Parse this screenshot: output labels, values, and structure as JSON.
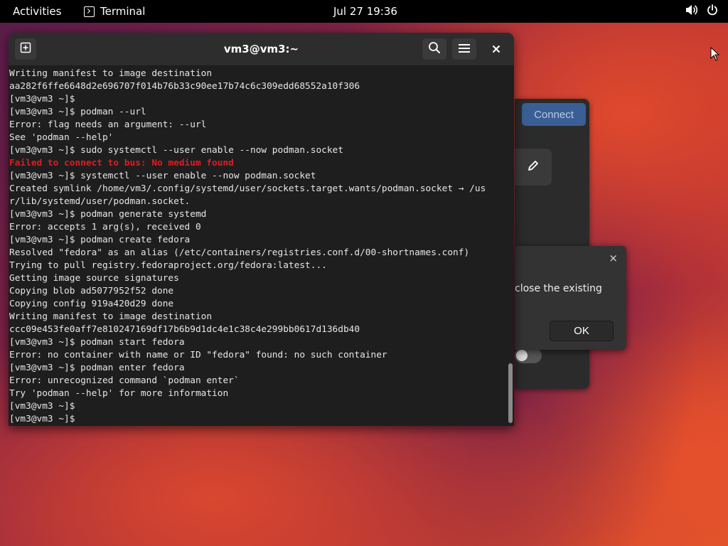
{
  "topbar": {
    "activities": "Activities",
    "app_name": "Terminal",
    "clock": "Jul 27  19:36",
    "icons": [
      "terminal-icon",
      "volume-icon",
      "power-icon"
    ]
  },
  "background_app": {
    "connect_label": "Connect",
    "icons": [
      "pencil-icon"
    ]
  },
  "dialog": {
    "message": "close the existing",
    "ok_label": "OK",
    "close_glyph": "×"
  },
  "terminal": {
    "title": "vm3@vm3:~",
    "icons": [
      "new-tab-icon",
      "search-icon",
      "menu-icon",
      "close-icon"
    ],
    "error_color": "#e01b24",
    "lines": [
      {
        "text": "Writing manifest to image destination"
      },
      {
        "text": "aa282f6ffe6648d2e696707f014b76b33c90ee17b74c6c309edd68552a10f306"
      },
      {
        "text": "[vm3@vm3 ~]$"
      },
      {
        "text": "[vm3@vm3 ~]$ podman --url"
      },
      {
        "text": "Error: flag needs an argument: --url"
      },
      {
        "text": "See 'podman --help'"
      },
      {
        "text": "[vm3@vm3 ~]$ sudo systemctl --user enable --now podman.socket"
      },
      {
        "text": "Failed to connect to bus: No medium found",
        "error": true
      },
      {
        "text": "[vm3@vm3 ~]$ systemctl --user enable --now podman.socket"
      },
      {
        "text": "Created symlink /home/vm3/.config/systemd/user/sockets.target.wants/podman.socket → /us"
      },
      {
        "text": "r/lib/systemd/user/podman.socket."
      },
      {
        "text": "[vm3@vm3 ~]$ podman generate systemd"
      },
      {
        "text": "Error: accepts 1 arg(s), received 0"
      },
      {
        "text": "[vm3@vm3 ~]$ podman create fedora"
      },
      {
        "text": "Resolved \"fedora\" as an alias (/etc/containers/registries.conf.d/00-shortnames.conf)"
      },
      {
        "text": "Trying to pull registry.fedoraproject.org/fedora:latest..."
      },
      {
        "text": "Getting image source signatures"
      },
      {
        "text": "Copying blob ad5077952f52 done"
      },
      {
        "text": "Copying config 919a420d29 done"
      },
      {
        "text": "Writing manifest to image destination"
      },
      {
        "text": "ccc09e453fe0aff7e810247169df17b6b9d1dc4e1c38c4e299bb0617d136db40"
      },
      {
        "text": "[vm3@vm3 ~]$ podman start fedora"
      },
      {
        "text": "Error: no container with name or ID \"fedora\" found: no such container"
      },
      {
        "text": "[vm3@vm3 ~]$ podman enter fedora"
      },
      {
        "text": "Error: unrecognized command `podman enter`"
      },
      {
        "text": "Try 'podman --help' for more information"
      },
      {
        "text": "[vm3@vm3 ~]$"
      },
      {
        "text": "[vm3@vm3 ~]$"
      }
    ]
  }
}
